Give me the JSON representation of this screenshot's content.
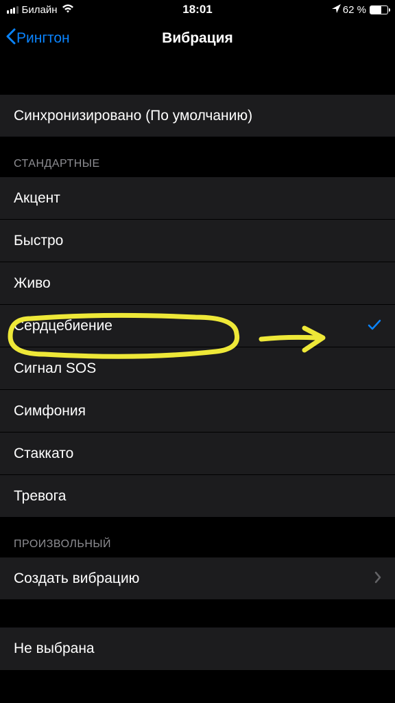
{
  "status": {
    "carrier": "Билайн",
    "time": "18:01",
    "battery_pct": "62 %"
  },
  "nav": {
    "back_label": "Рингтон",
    "title": "Вибрация"
  },
  "sync": {
    "label": "Синхронизировано (По умолчанию)"
  },
  "sections": {
    "standard_header": "Стандартные",
    "custom_header": "Произвольный"
  },
  "standard_items": [
    {
      "label": "Акцент",
      "selected": false
    },
    {
      "label": "Быстро",
      "selected": false
    },
    {
      "label": "Живо",
      "selected": false
    },
    {
      "label": "Сердцебиение",
      "selected": true
    },
    {
      "label": "Сигнал SOS",
      "selected": false
    },
    {
      "label": "Симфония",
      "selected": false
    },
    {
      "label": "Стаккато",
      "selected": false
    },
    {
      "label": "Тревога",
      "selected": false
    }
  ],
  "custom": {
    "create_label": "Создать вибрацию"
  },
  "none": {
    "label": "Не выбрана"
  },
  "annotation": {
    "highlighted_item": "Сердцебиение",
    "color": "#eee838"
  }
}
